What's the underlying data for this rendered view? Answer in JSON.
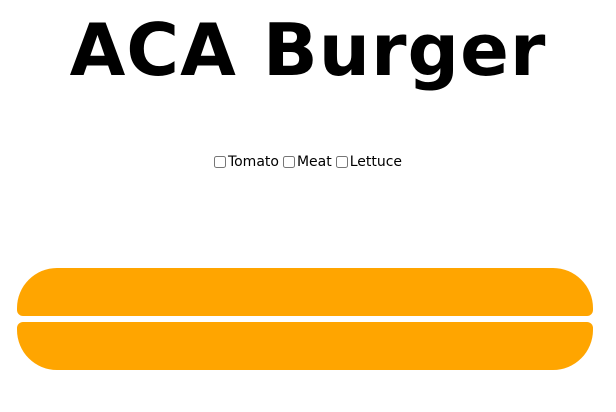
{
  "header": {
    "title": "ACA Burger"
  },
  "ingredients": [
    {
      "label": "Tomato",
      "checked": false
    },
    {
      "label": "Meat",
      "checked": false
    },
    {
      "label": "Lettuce",
      "checked": false
    }
  ],
  "colors": {
    "bun": "#FFA500",
    "background": "#FFFFFF",
    "text": "#000000"
  }
}
